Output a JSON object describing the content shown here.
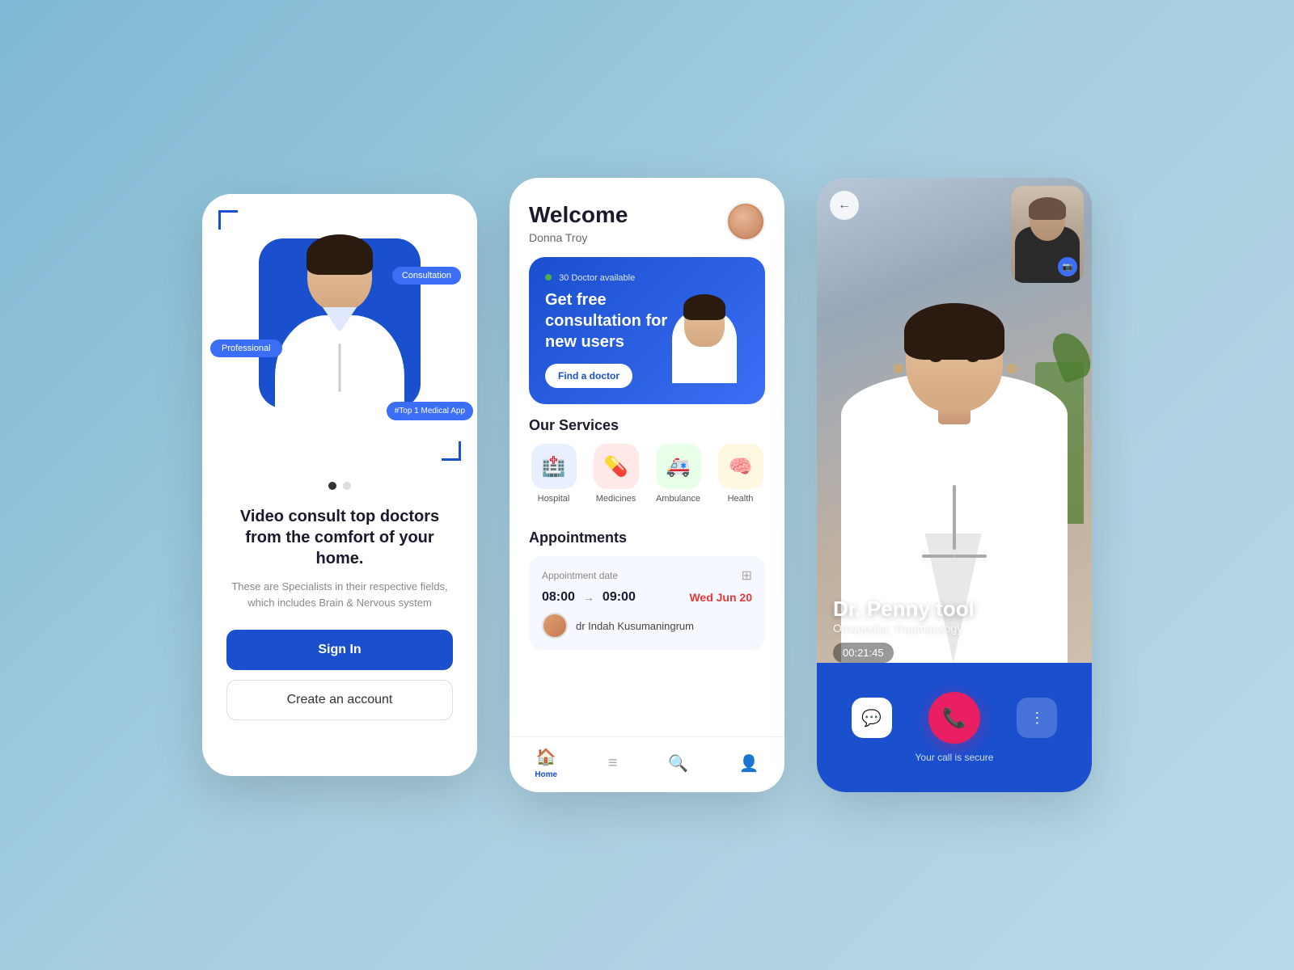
{
  "page": {
    "bg_color": "#7eb8d4"
  },
  "phone1": {
    "tag_consultation": "Consultation",
    "tag_professional": "Professional",
    "tag_medical": "#Top 1 Medical App",
    "title": "Video consult top doctors from the comfort of your home.",
    "subtitle": "These are Specialists in their respective fields, which includes Brain & Nervous system",
    "btn_signin": "Sign In",
    "btn_create": "Create an account",
    "dot1": "active",
    "dot2": ""
  },
  "phone2": {
    "welcome": "Welcome",
    "name": "Donna Troy",
    "banner_available": "30 Doctor available",
    "banner_title": "Get free consultation for new users",
    "banner_btn": "Find a doctor",
    "services_title": "Our Services",
    "services": [
      {
        "label": "Hospital",
        "icon": "🏥",
        "class": "service-hospital"
      },
      {
        "label": "Medicines",
        "icon": "💊",
        "class": "service-medicines"
      },
      {
        "label": "Ambulance",
        "icon": "🚑",
        "class": "service-ambulance"
      },
      {
        "label": "Health",
        "icon": "🧠",
        "class": "service-health"
      }
    ],
    "appointments_title": "Appointments",
    "appt_date_label": "Appointment date",
    "appt_time_start": "08:00",
    "appt_time_end": "09:00",
    "appt_day": "Wed Jun 20",
    "appt_doctor": "dr Indah Kusumaningrum",
    "nav_home": "Home",
    "nav_list": "",
    "nav_search": "",
    "nav_profile": ""
  },
  "phone3": {
    "back_icon": "←",
    "camera_icon": "📷",
    "doctor_name": "Dr. Penny tool",
    "doctor_spec": "Othopedist, Traumatology",
    "timer": "00:21:45",
    "chat_icon": "💬",
    "end_icon": "📞",
    "more_icon": "⋮",
    "secure_text": "Your call is secure"
  }
}
